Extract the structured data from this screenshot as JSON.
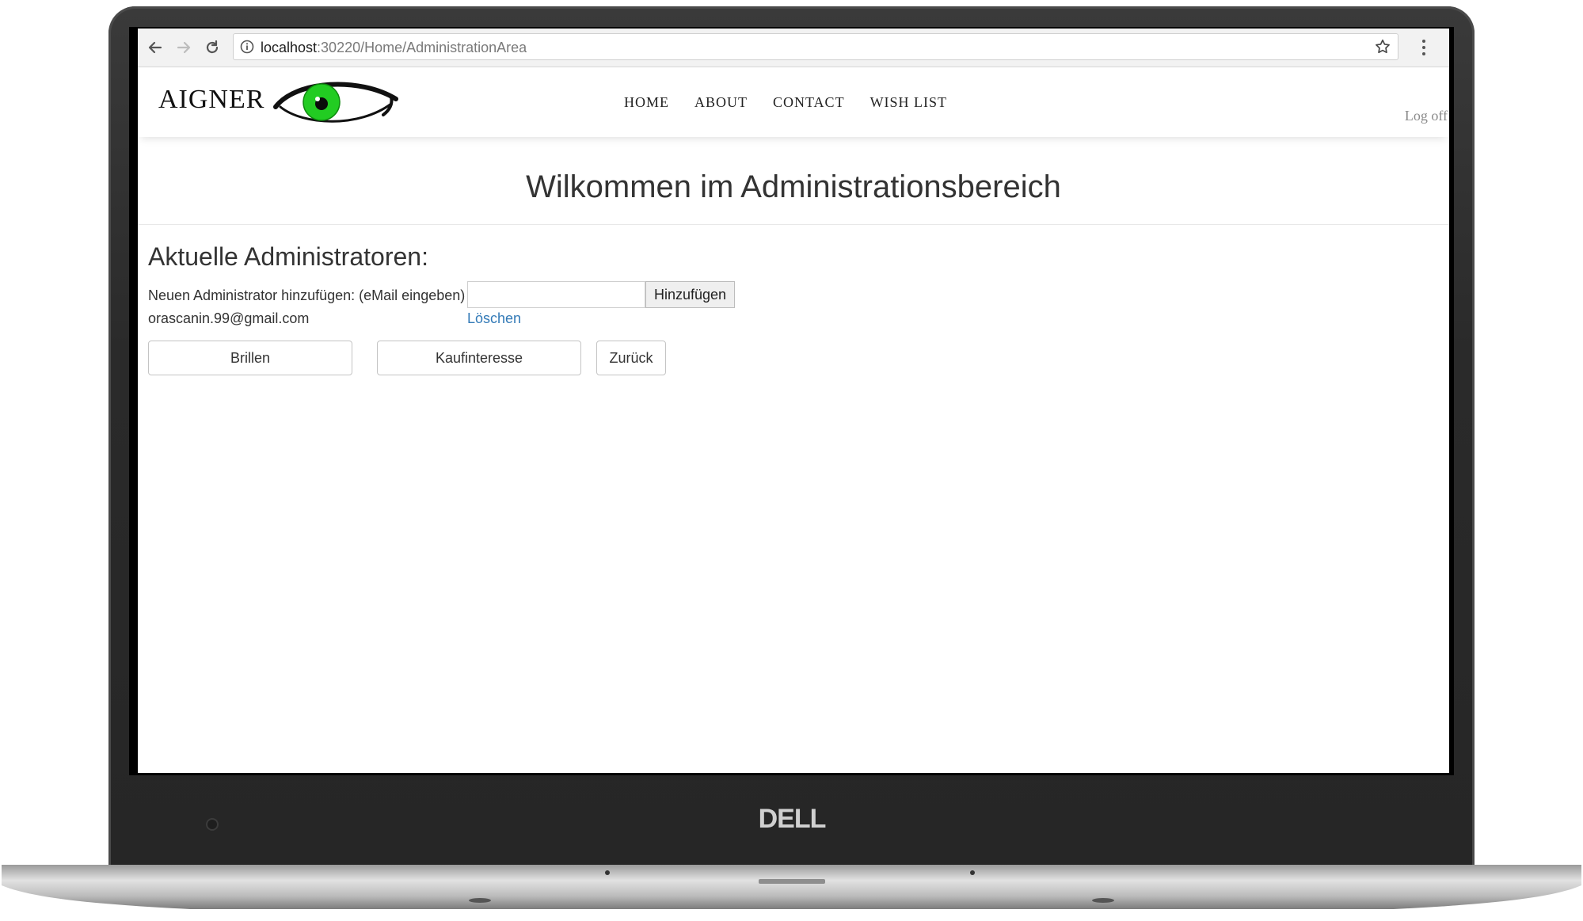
{
  "browser": {
    "url_host": "localhost",
    "url_path": ":30220/Home/AdministrationArea"
  },
  "site": {
    "brand": "AIGNER",
    "nav": [
      "HOME",
      "ABOUT",
      "CONTACT",
      "WISH LIST"
    ],
    "logoff_label": "Log off"
  },
  "page": {
    "title": "Wilkommen im Administrationsbereich",
    "admins_heading": "Aktuelle Administratoren:",
    "add_admin_label": "Neuen Administrator hinzufügen: (eMail eingeben)",
    "email_input_value": "",
    "add_button_label": "Hinzufügen",
    "admins": [
      {
        "email": "orascanin.99@gmail.com",
        "delete_label": "Löschen"
      }
    ],
    "buttons": {
      "brillen": "Brillen",
      "kaufinteresse": "Kaufinteresse",
      "zurueck": "Zurück"
    }
  },
  "device": {
    "brand_logo": "DELL"
  },
  "colors": {
    "link": "#337ab7",
    "eye_green": "#22cc22"
  }
}
